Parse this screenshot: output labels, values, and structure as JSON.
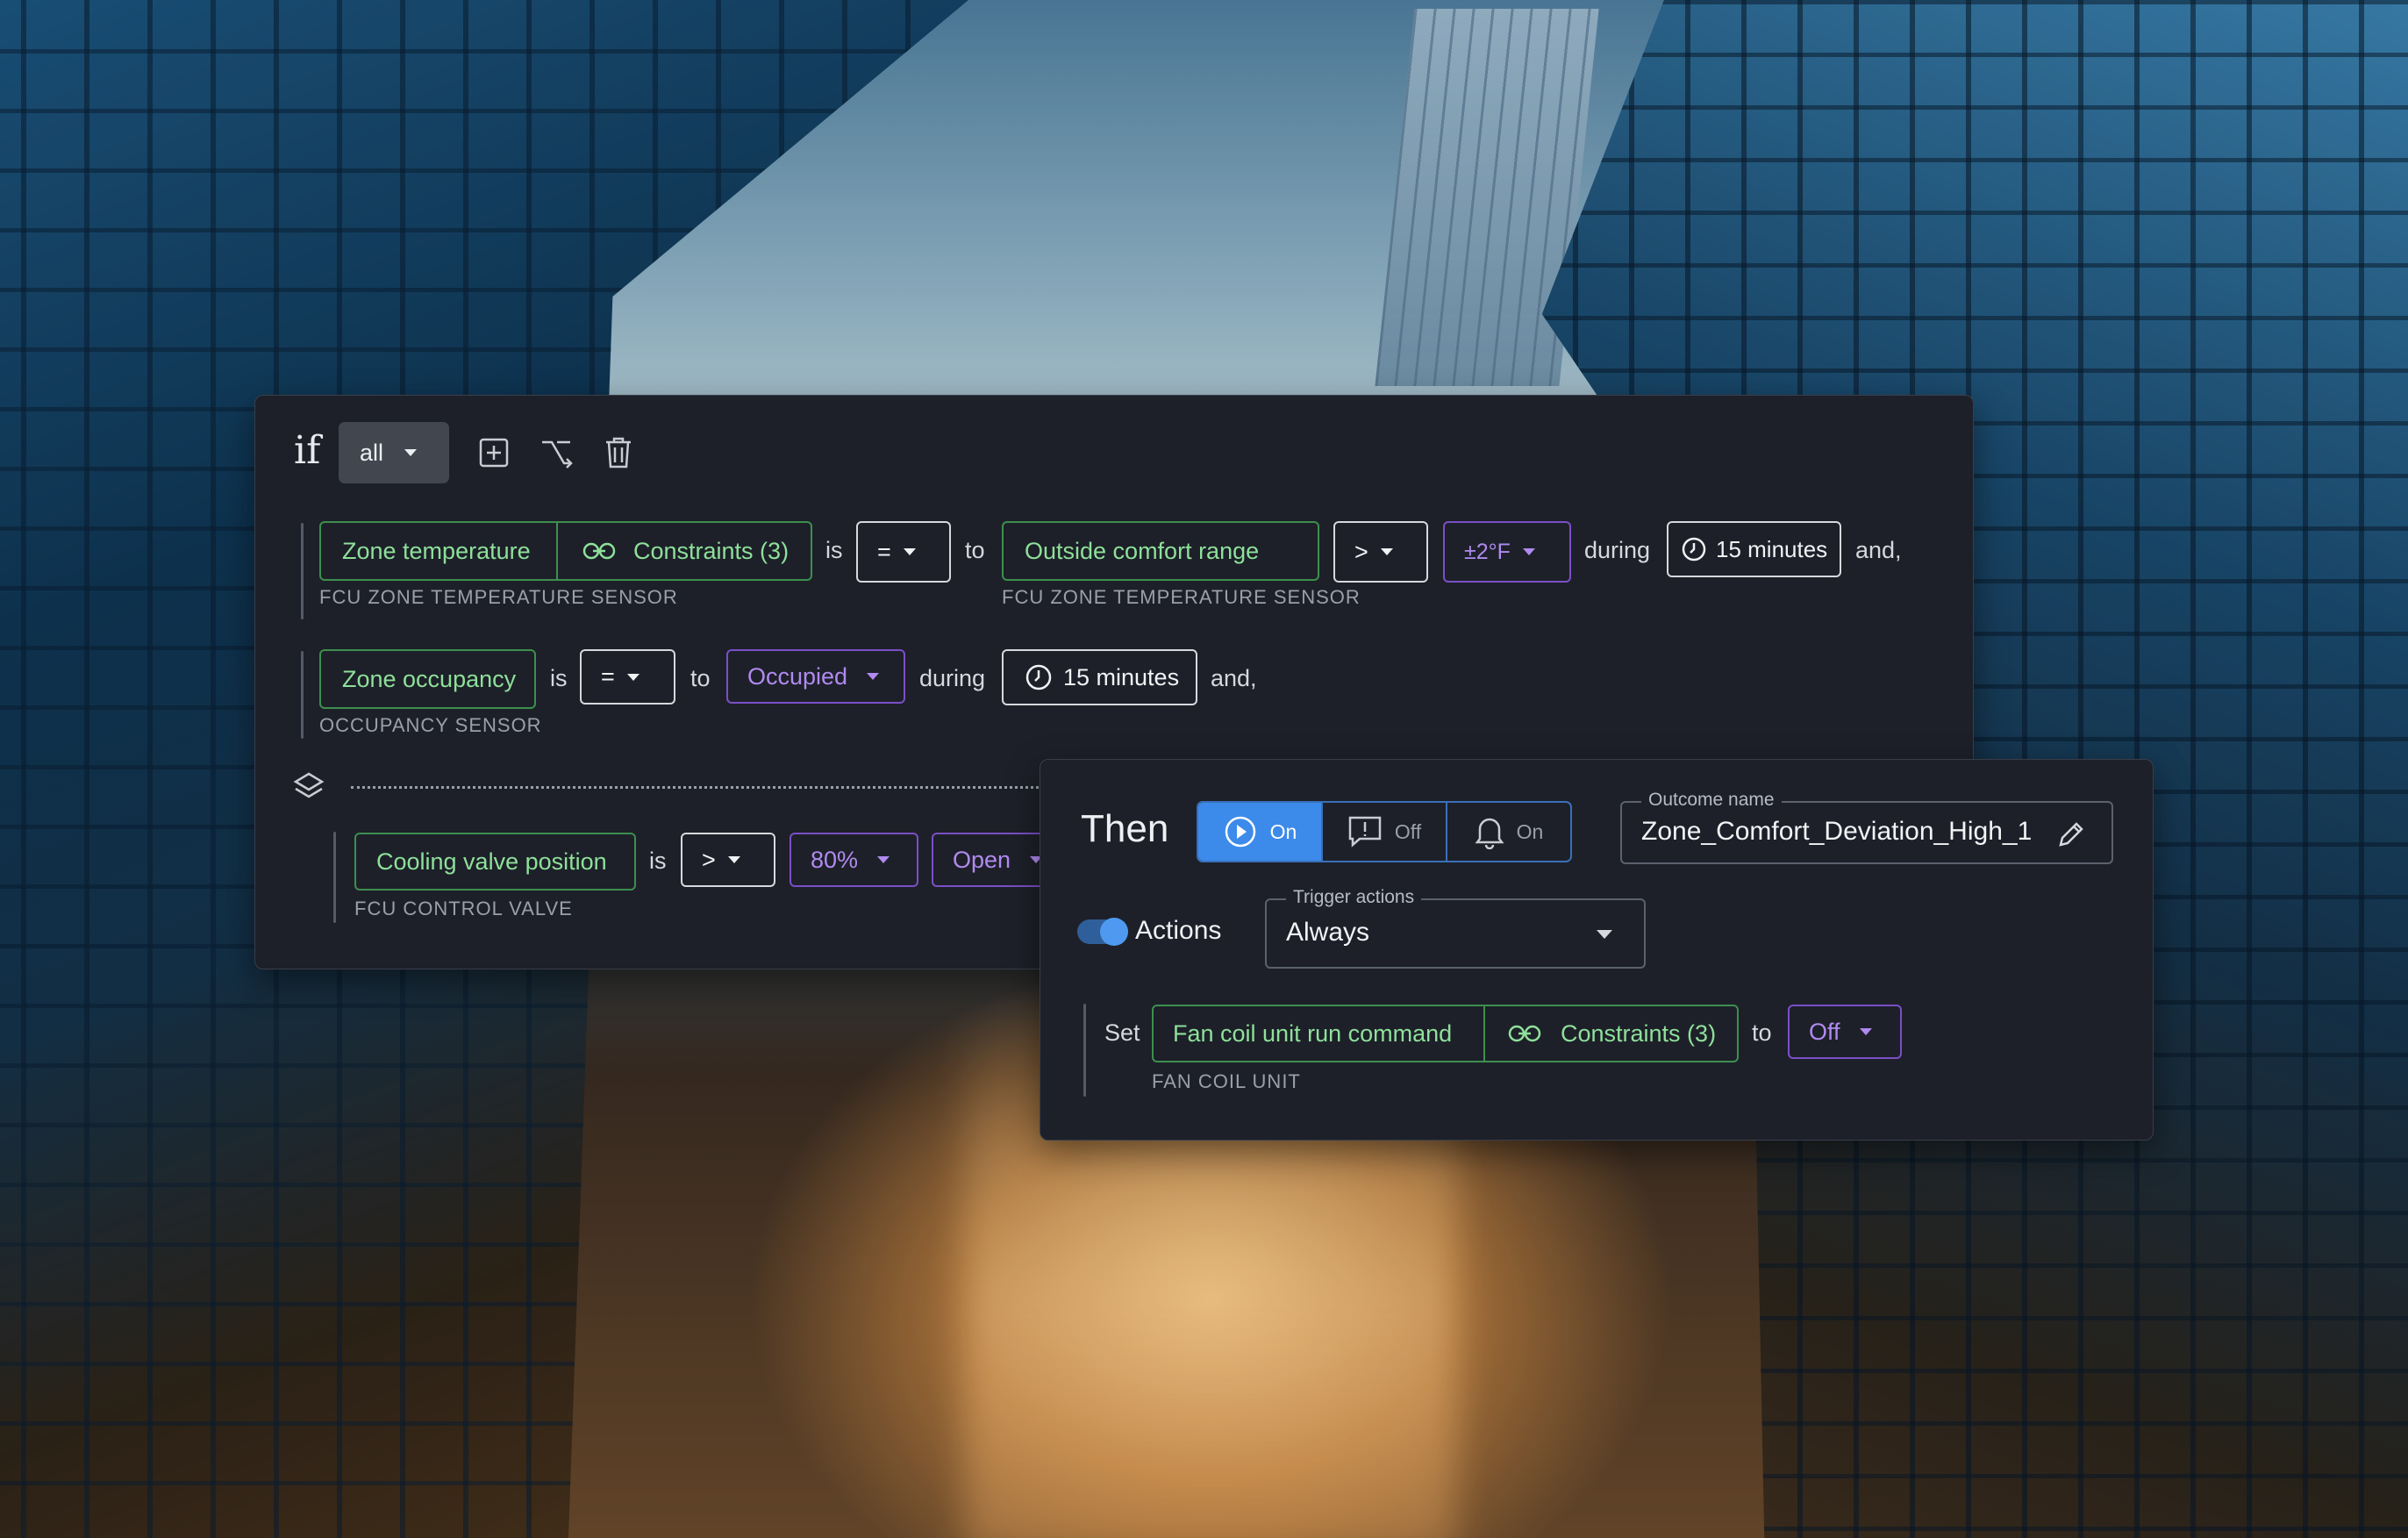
{
  "colors": {
    "panel_bg": "#1d2029",
    "green_border": "#3d8f4e",
    "green_text": "#8ee09a",
    "purple_border": "#7b4fc6",
    "purple_text": "#b08af0",
    "active_blue": "#3c8bea"
  },
  "if_block": {
    "label": "if",
    "match_mode": "all",
    "toolbar": {
      "add_icon": "plus-square-icon",
      "branch_icon": "branch-icon",
      "delete_icon": "trash-icon"
    },
    "conditions": [
      {
        "field": "Zone temperature",
        "constraints": "Constraints (3)",
        "subtitle": "FCU ZONE TEMPERATURE SENSOR",
        "is": "is",
        "operator": "=",
        "to": "to",
        "target": "Outside comfort range",
        "target_subtitle": "FCU ZONE TEMPERATURE SENSOR",
        "compare": ">",
        "tolerance": "±2°F",
        "during": "during",
        "duration": "15 minutes",
        "join": "and,"
      },
      {
        "field": "Zone occupancy",
        "subtitle": "OCCUPANCY SENSOR",
        "is": "is",
        "operator": "=",
        "to": "to",
        "target": "Occupied",
        "during": "during",
        "duration": "15 minutes",
        "join": "and,"
      },
      {
        "field": "Cooling valve position",
        "subtitle": "FCU CONTROL VALVE",
        "is": "is",
        "operator": ">",
        "value": "80%",
        "state": "Open"
      }
    ]
  },
  "then_block": {
    "title": "Then",
    "modes": [
      {
        "icon": "play-circle-icon",
        "label": "On",
        "active": true
      },
      {
        "icon": "alert-message-icon",
        "label": "Off",
        "active": false
      },
      {
        "icon": "bell-icon",
        "label": "On",
        "active": false
      }
    ],
    "outcome_name_label": "Outcome name",
    "outcome_name_value": "Zone_Comfort_Deviation_High_1",
    "actions_label": "Actions",
    "trigger_actions_label": "Trigger actions",
    "trigger_actions_value": "Always",
    "set_row": {
      "set": "Set",
      "field": "Fan coil unit run command",
      "constraints": "Constraints (3)",
      "subtitle": "FAN COIL UNIT",
      "to": "to",
      "value": "Off"
    }
  }
}
